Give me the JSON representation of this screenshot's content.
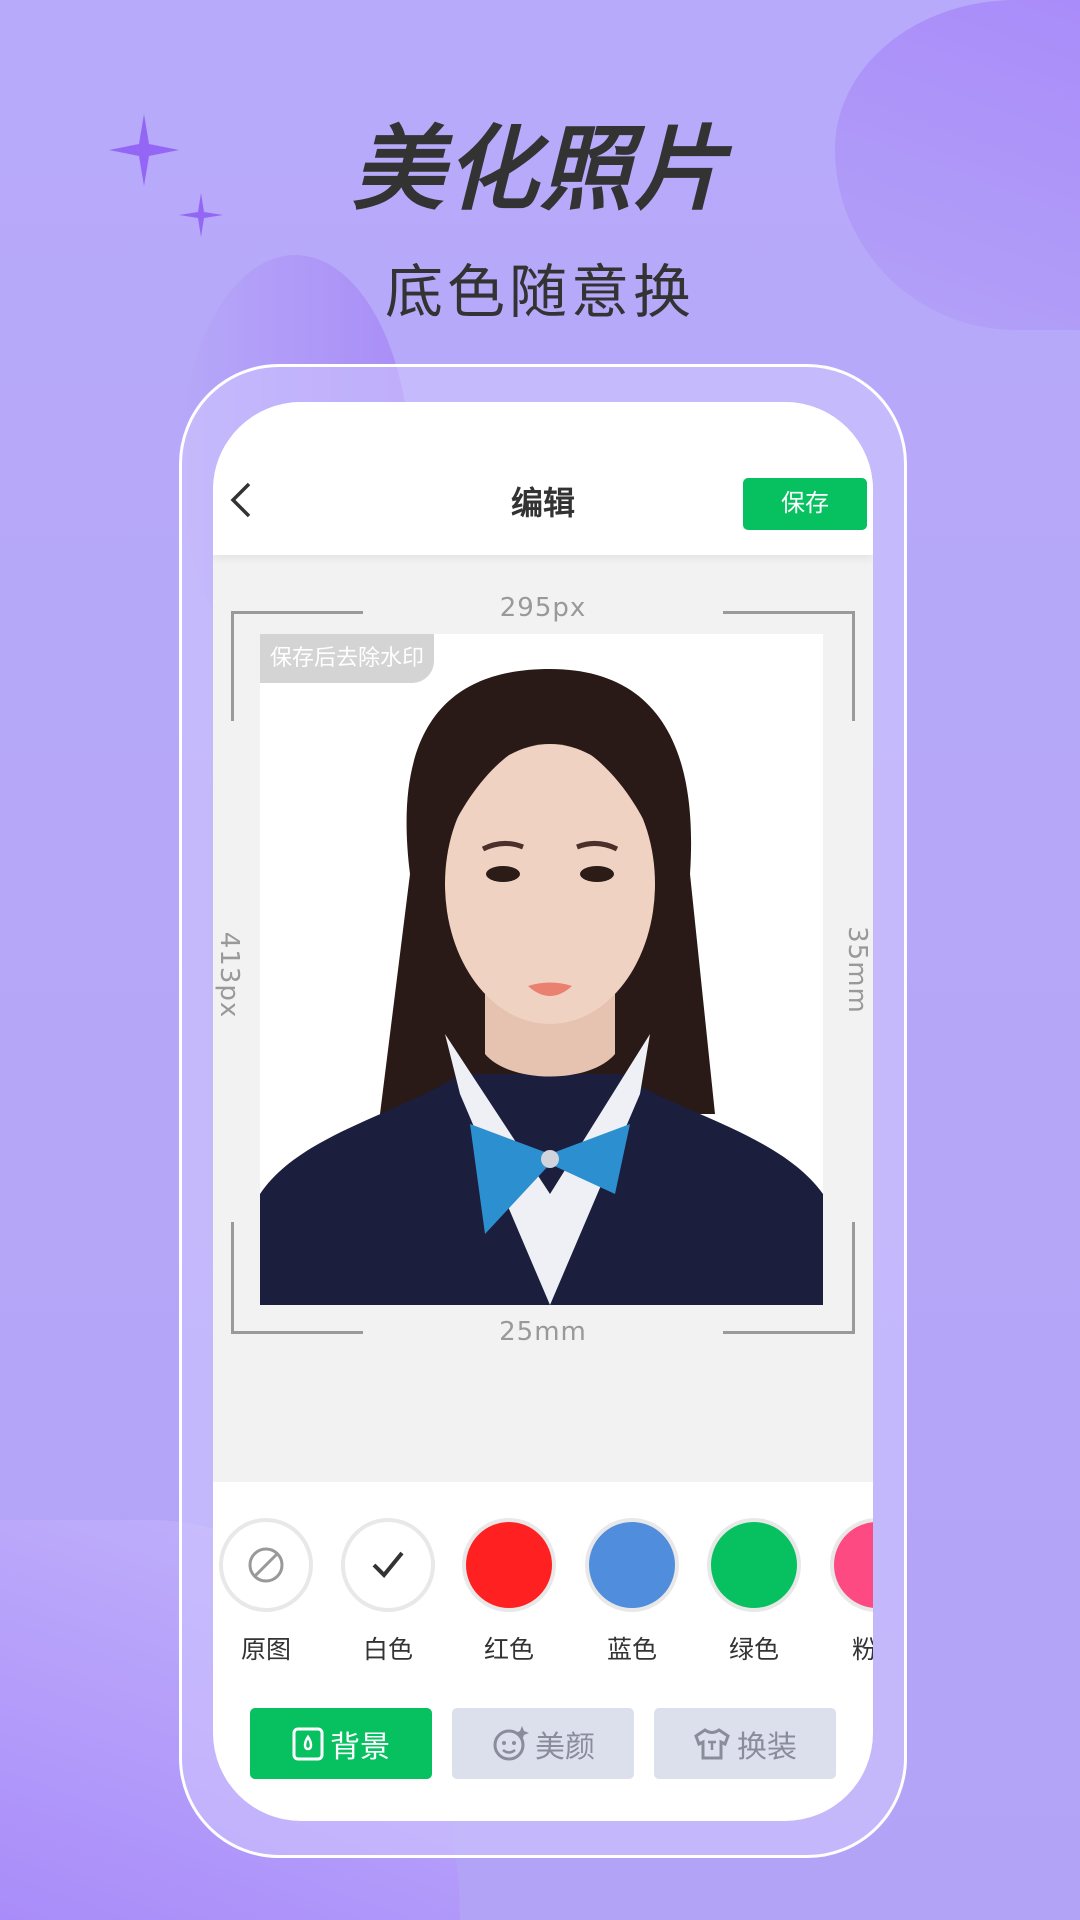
{
  "promo": {
    "title": "美化照片",
    "subtitle": "底色随意换"
  },
  "colors": {
    "accent": "#07c160",
    "sparkle": "#9466f5",
    "background": "#b6a8f9"
  },
  "header": {
    "title": "编辑",
    "back_icon": "chevron-left-icon",
    "save_label": "保存"
  },
  "editor": {
    "width_px": "295px",
    "height_px": "413px",
    "width_mm": "25mm",
    "height_mm": "35mm",
    "watermark": "保存后去除水印"
  },
  "swatches": [
    {
      "label": "原图",
      "color": "#ffffff",
      "icon": "no-symbol-icon"
    },
    {
      "label": "白色",
      "color": "#ffffff",
      "icon": "check-icon",
      "selected": true
    },
    {
      "label": "红色",
      "color": "#ff2121"
    },
    {
      "label": "蓝色",
      "color": "#508ddc"
    },
    {
      "label": "绿色",
      "color": "#07c160"
    },
    {
      "label": "粉色",
      "color": "#fd4a82"
    }
  ],
  "tabs": [
    {
      "label": "背景",
      "icon": "background-drop-icon",
      "active": true
    },
    {
      "label": "美颜",
      "icon": "face-sparkle-icon",
      "active": false
    },
    {
      "label": "换装",
      "icon": "shirt-icon",
      "active": false
    }
  ]
}
